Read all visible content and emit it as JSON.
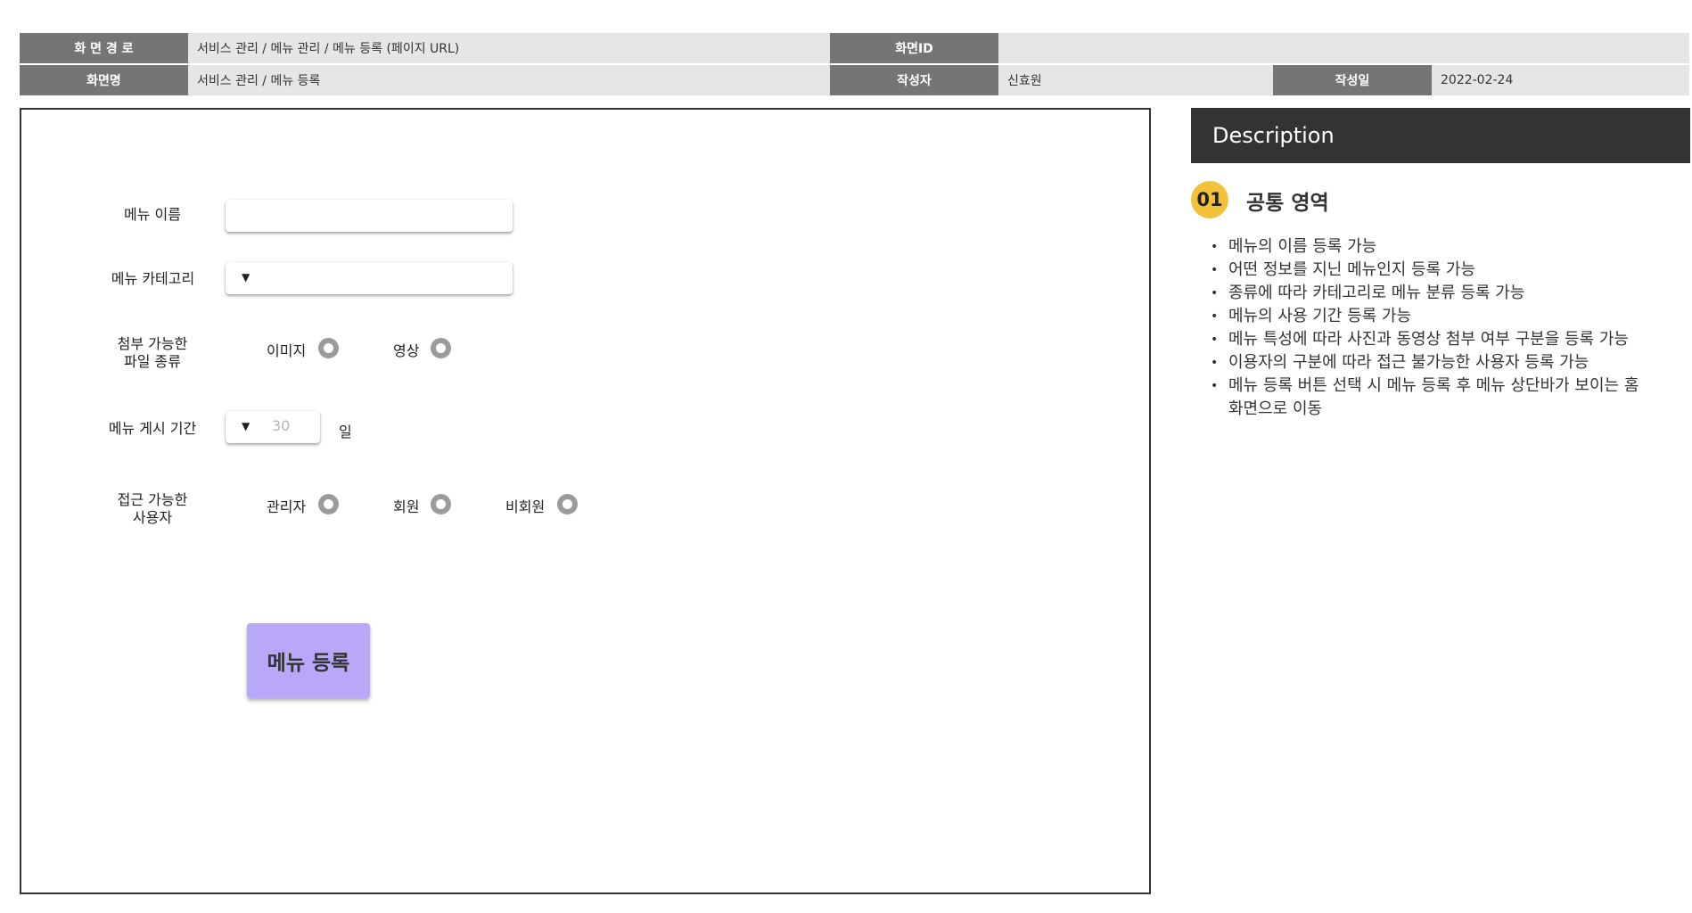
{
  "header": {
    "screen_path_label": "화 면 경 로",
    "screen_path_value": "서비스 관리 / 메뉴 관리 / 메뉴 등록 (페이지 URL)",
    "screen_id_label": "화면ID",
    "screen_id_value": "",
    "screen_name_label": "화면명",
    "screen_name_value": "서비스 관리 / 메뉴 등록",
    "author_label": "작성자",
    "author_value": "신효원",
    "date_label": "작성일",
    "date_value": "2022-02-24"
  },
  "form": {
    "menu_name_label": "메뉴 이름",
    "menu_name_value": "",
    "menu_category_label": "메뉴 카테고리",
    "menu_category_value": "",
    "file_type_label_line1": "첨부 가능한",
    "file_type_label_line2": "파일 종류",
    "file_type_options": [
      "이미지",
      "영상"
    ],
    "period_label": "메뉴 게시 기간",
    "period_placeholder": "30",
    "period_unit": "일",
    "access_label_line1": "접근 가능한",
    "access_label_line2": "사용자",
    "access_options": [
      "관리자",
      "회원",
      "비회원"
    ],
    "submit_label": "메뉴 등록",
    "dropdown_glyph": "▼"
  },
  "description": {
    "title": "Description",
    "section_number": "01",
    "section_title": "공통 영역",
    "items": [
      "메뉴의 이름 등록 가능",
      "어떤 정보를 지닌 메뉴인지 등록 가능",
      "종류에 따라 카테고리로 메뉴 분류 등록 가능",
      "메뉴의 사용 기간 등록 가능",
      "메뉴 특성에 따라 사진과 동영상 첨부 여부 구분을 등록 가능",
      "이용자의 구분에 따라 접근 불가능한 사용자 등록 가능",
      "메뉴 등록 버튼 선택 시 메뉴 등록 후 메뉴 상단바가 보이는 홈 화면으로 이동"
    ]
  },
  "colors": {
    "header_label_bg": "#757575",
    "header_value_bg": "#e6e6e6",
    "description_header_bg": "#333333",
    "badge_bg": "#f2c33a",
    "submit_button_bg": "#b9a7f7",
    "radio_color": "#9b9b9b"
  }
}
